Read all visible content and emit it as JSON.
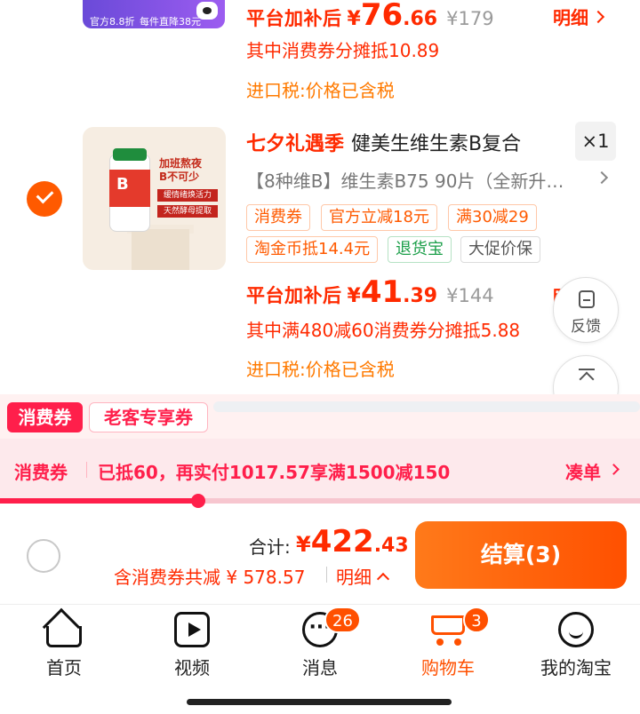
{
  "top_item": {
    "thumb_text_left": "官方8.8折",
    "thumb_text_right": "每件直降38元",
    "price_label": "平台加补后",
    "price_yen": "¥",
    "price_int": "76",
    "price_dec": ".66",
    "original_price": "¥179",
    "detail_label": "明细",
    "coupon_share": "其中消费券分摊抵10.89",
    "tax_note": "进口税:价格已含税"
  },
  "item2": {
    "image_promo_line1": "加班熬夜",
    "image_promo_line2": "B不可少",
    "image_badge1": "缓情绪焕活力",
    "image_badge2": "天然酵母提取",
    "image_bottle_label": "B",
    "festival_label": "七夕礼遇季",
    "title": "健美生维生素B复合",
    "quantity": "×1",
    "sku": "【8种维B】维生素B75 90片（全新升…",
    "tags": [
      "消费券",
      "官方立减18元",
      "满30减29",
      "淘金币抵14.4元",
      "退货宝",
      "大促价保"
    ],
    "price_label": "平台加补后",
    "price_yen": "¥",
    "price_int": "41",
    "price_dec": ".39",
    "original_price": "¥144",
    "detail_label": "明细",
    "coupon_share": "其中满480减60消费券分摊抵5.88",
    "tax_note": "进口税:价格已含税"
  },
  "float_buttons": {
    "feedback": "反馈",
    "top": "顶部"
  },
  "coupon_tabs": {
    "tab1": "消费券",
    "tab2": "老客专享券"
  },
  "coupon_bar": {
    "label": "消费券",
    "message": "已抵60，再实付1017.57享满1500减150",
    "action": "凑单",
    "progress": 0.31
  },
  "checkout": {
    "total_label": "合计:",
    "total_yen": "¥",
    "total_int": "422",
    "total_dec": ".43",
    "saving_text": "含消费券共减 ¥ 578.57",
    "detail_label": "明细",
    "button_label": "结算(3)"
  },
  "tabbar": {
    "home": "首页",
    "video": "视频",
    "messages": "消息",
    "messages_badge": "26",
    "cart": "购物车",
    "cart_badge": "3",
    "me": "我的淘宝"
  },
  "colors": {
    "accent": "#ff5000",
    "price_red": "#ff2a00",
    "coupon_pink": "#ff1f4b",
    "tax_orange": "#ff7a00"
  }
}
